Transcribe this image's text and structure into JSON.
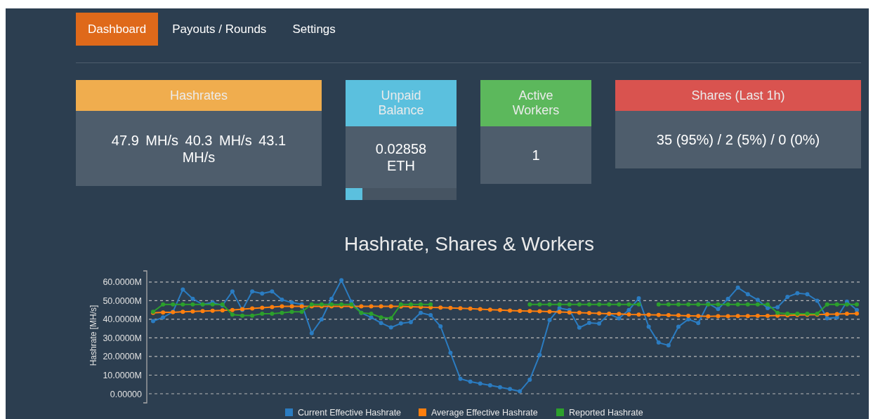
{
  "nav": [
    {
      "label": "Dashboard",
      "selected": true
    },
    {
      "label": "Payouts / Rounds",
      "selected": false
    },
    {
      "label": "Settings",
      "selected": false
    }
  ],
  "cards": [
    {
      "title": "Hashrates",
      "color": "#f0ad4e",
      "value": "47.9 MH/s  40.3 MH/s   43.1 MH/s"
    },
    {
      "title": "Unpaid Balance",
      "color": "#5bc0de",
      "value": "0.02858 ETH",
      "level": 0.15
    },
    {
      "title": "Active Workers",
      "color": "#5cb85c",
      "value": "1"
    },
    {
      "title": "Shares (Last 1h)",
      "color": "#d9534f",
      "value": "35 (95%) / 2 (5%) / 0 (0%)"
    }
  ],
  "chart": {
    "title": "Hashrate, Shares & Workers",
    "chart_data": {
      "type": "line",
      "ylabel": "Hashrate [MH/s]",
      "ylim": [
        0,
        66
      ],
      "grid": true,
      "legend": true,
      "yticks": [
        {
          "value": 0,
          "label": "0.00000"
        },
        {
          "value": 10,
          "label": "10.0000M"
        },
        {
          "value": 20,
          "label": "20.0000M"
        },
        {
          "value": 30,
          "label": "30.0000M"
        },
        {
          "value": 40,
          "label": "40.0000M"
        },
        {
          "value": 50,
          "label": "50.0000M"
        },
        {
          "value": 60,
          "label": "60.0000M"
        }
      ],
      "series": [
        {
          "name": "Current Effective Hashrate",
          "color": "#2b7cc1",
          "marker": "circle",
          "values": [
            39,
            41,
            44,
            56,
            51,
            48,
            49,
            47.5,
            55,
            45,
            55,
            53.8,
            55,
            50.5,
            49,
            48,
            32.5,
            40,
            51,
            61,
            49.5,
            43.5,
            41,
            38,
            35.6,
            37.8,
            38.5,
            43.5,
            42.2,
            36.2,
            22,
            8,
            6.5,
            5.5,
            4.5,
            3.5,
            2.5,
            1.3,
            7.5,
            20.8,
            39.6,
            46,
            45,
            35.5,
            38.1,
            37.7,
            42.9,
            40.5,
            45,
            51.3,
            36,
            27.5,
            26,
            36,
            40,
            38,
            48.5,
            45.5,
            51,
            57,
            53.5,
            50.4,
            46,
            46.5,
            52,
            54,
            53.5,
            50,
            40.5,
            41,
            49.5,
            45
          ]
        },
        {
          "name": "Average Effective Hashrate",
          "color": "#ff7f0e",
          "marker": "circle",
          "values": [
            43.5,
            43.7,
            43.8,
            44,
            44.2,
            44.4,
            44.6,
            44.8,
            45,
            45.4,
            45.8,
            46.2,
            46.6,
            47,
            47,
            47,
            47,
            47,
            47,
            47,
            47,
            47,
            47,
            47,
            47,
            46.9,
            46.8,
            46.6,
            46.4,
            46.3,
            46.1,
            45.9,
            45.7,
            45.4,
            45.2,
            45,
            44.7,
            44.5,
            44.4,
            44.3,
            44.1,
            43.9,
            43.7,
            43.6,
            43.4,
            43.2,
            43,
            42.9,
            42.6,
            42.5,
            42.4,
            42.3,
            42.2,
            42.1,
            41.9,
            41.8,
            41.6,
            41.7,
            41.7,
            41.8,
            41.8,
            41.9,
            41.9,
            42,
            42.1,
            42.3,
            42.4,
            42.5,
            42.7,
            42.8,
            43,
            43.1
          ]
        },
        {
          "name": "Reported Hashrate",
          "color": "#2ca02c",
          "marker": "circle",
          "values": [
            44,
            48,
            48,
            48,
            48,
            48,
            48,
            48,
            42.5,
            42,
            42,
            43,
            43,
            43.5,
            44,
            44,
            48,
            48,
            48,
            48,
            48,
            43.5,
            43,
            41,
            40.5,
            48,
            48,
            48,
            48,
            null,
            null,
            null,
            null,
            null,
            null,
            null,
            null,
            null,
            48,
            48,
            48,
            48,
            48,
            48,
            48,
            48,
            48,
            48,
            48,
            48,
            null,
            48,
            48,
            48,
            48,
            48,
            48,
            48,
            48,
            48,
            48,
            48,
            48,
            43.5,
            43,
            43,
            43,
            43,
            48,
            48,
            48,
            48
          ]
        }
      ]
    }
  }
}
